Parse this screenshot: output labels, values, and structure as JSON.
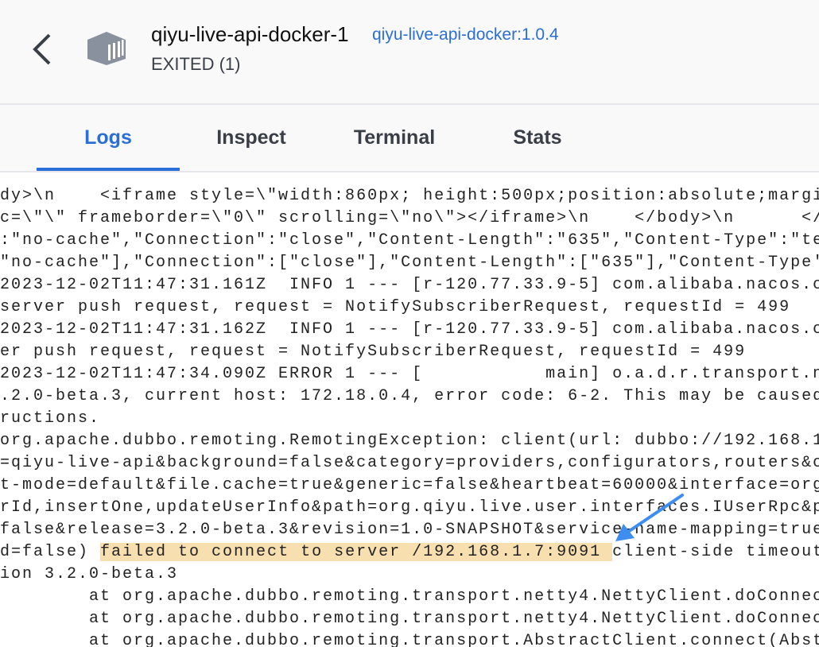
{
  "header": {
    "container_name": "qiyu-live-api-docker-1",
    "image_link": "qiyu-live-api-docker:1.0.4",
    "status": "EXITED (1)",
    "back_icon": "chevron-left-icon",
    "container_icon": "container-cube-icon"
  },
  "tabs": [
    {
      "label": "Logs",
      "active": true
    },
    {
      "label": "Inspect",
      "active": false
    },
    {
      "label": "Terminal",
      "active": false
    },
    {
      "label": "Stats",
      "active": false
    }
  ],
  "colors": {
    "accent": "#2b6fd6",
    "highlight": "#f8dfb0",
    "annotation_arrow": "#3d8ef0"
  },
  "logs": {
    "lines": [
      "dy>\\n    <iframe style=\\\"width:860px; height:500px;position:absolute;margi",
      "c=\\\"\\\" frameborder=\\\"0\\\" scrolling=\\\"no\\\"></iframe>\\n    </body>\\n      </",
      ":\"no-cache\",\"Connection\":\"close\",\"Content-Length\":\"635\",\"Content-Type\":\"te",
      "\"no-cache\"],\"Connection\":[\"close\"],\"Content-Length\":[\"635\"],\"Content-Type'",
      "2023-12-02T11:47:31.161Z  INFO 1 --- [r-120.77.33.9-5] com.alibaba.nacos.c",
      "server push request, request = NotifySubscriberRequest, requestId = 499",
      "2023-12-02T11:47:31.162Z  INFO 1 --- [r-120.77.33.9-5] com.alibaba.nacos.c",
      "er push request, request = NotifySubscriberRequest, requestId = 499",
      "2023-12-02T11:47:34.090Z ERROR 1 --- [           main] o.a.d.r.transport.n",
      ".2.0-beta.3, current host: 172.18.0.4, error code: 6-2. This may be caused",
      "ructions.",
      "org.apache.dubbo.remoting.RemotingException: client(url: dubbo://192.168.1",
      "=qiyu-live-api&background=false&category=providers,configurators,routers&c",
      "t-mode=default&file.cache=true&generic=false&heartbeat=60000&interface=org",
      "rId,insertOne,updateUserInfo&path=org.qiyu.live.user.interfaces.IUserRpc&p",
      "false&release=3.2.0-beta.3&revision=1.0-SNAPSHOT&service-name-mapping=true",
      "ion 3.2.0-beta.3",
      "        at org.apache.dubbo.remoting.transport.netty4.NettyClient.doConnec",
      "        at org.apache.dubbo.remoting.transport.netty4.NettyClient.doConnec",
      "        at org.apache.dubbo.remoting.transport.AbstractClient.connect(Abst"
    ],
    "highlight_line": {
      "prefix": "d=false) ",
      "highlighted": "failed to connect to server /192.168.1.7:9091 ",
      "suffix": "client-side timeout"
    }
  }
}
